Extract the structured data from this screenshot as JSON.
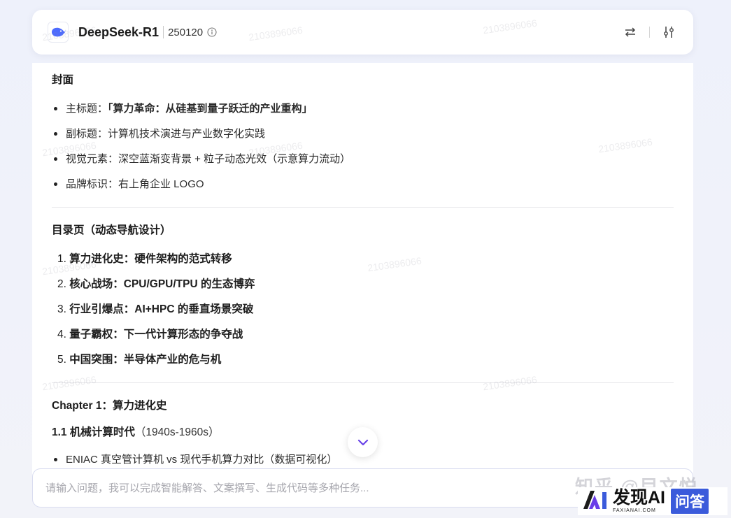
{
  "header": {
    "model_name": "DeepSeek-R1",
    "version": "250120"
  },
  "content": {
    "cover": {
      "title": "封面",
      "items": [
        {
          "label": "主标题：",
          "value": "「算力革命：从硅基到量子跃迁的产业重构」"
        },
        {
          "label": "副标题：",
          "value": "计算机技术演进与产业数字化实践"
        },
        {
          "label": "视觉元素：",
          "value": "深空蓝渐变背景 + 粒子动态光效（示意算力流动）"
        },
        {
          "label": "品牌标识：",
          "value": "右上角企业 LOGO"
        }
      ]
    },
    "toc": {
      "title": "目录页（动态导航设计）",
      "items": [
        {
          "num": "1.",
          "text": "算力进化史：硬件架构的范式转移"
        },
        {
          "num": "2.",
          "text": "核心战场：CPU/GPU/TPU 的生态博弈"
        },
        {
          "num": "3.",
          "text": "行业引爆点：AI+HPC 的垂直场景突破"
        },
        {
          "num": "4.",
          "text": "量子霸权：下一代计算形态的争夺战"
        },
        {
          "num": "5.",
          "text": "中国突围：半导体产业的危与机"
        }
      ]
    },
    "chapter": {
      "title": "Chapter 1：算力进化史",
      "section_title": "1.1 机械计算时代",
      "section_period": "（1940s-1960s）",
      "items": [
        "ENIAC 真空管计算机 vs 现代手机算力对比（数据可视化）"
      ]
    }
  },
  "input": {
    "placeholder": "请输入问题，我可以完成智能解答、文案撰写、生成代码等多种任务..."
  },
  "watermark": {
    "id_text": "2103896066",
    "zhihu": "知乎 @目文悦",
    "brand_main": "发现AI",
    "brand_sub": "FAXIANAI.COM",
    "brand_tag": "问答"
  }
}
